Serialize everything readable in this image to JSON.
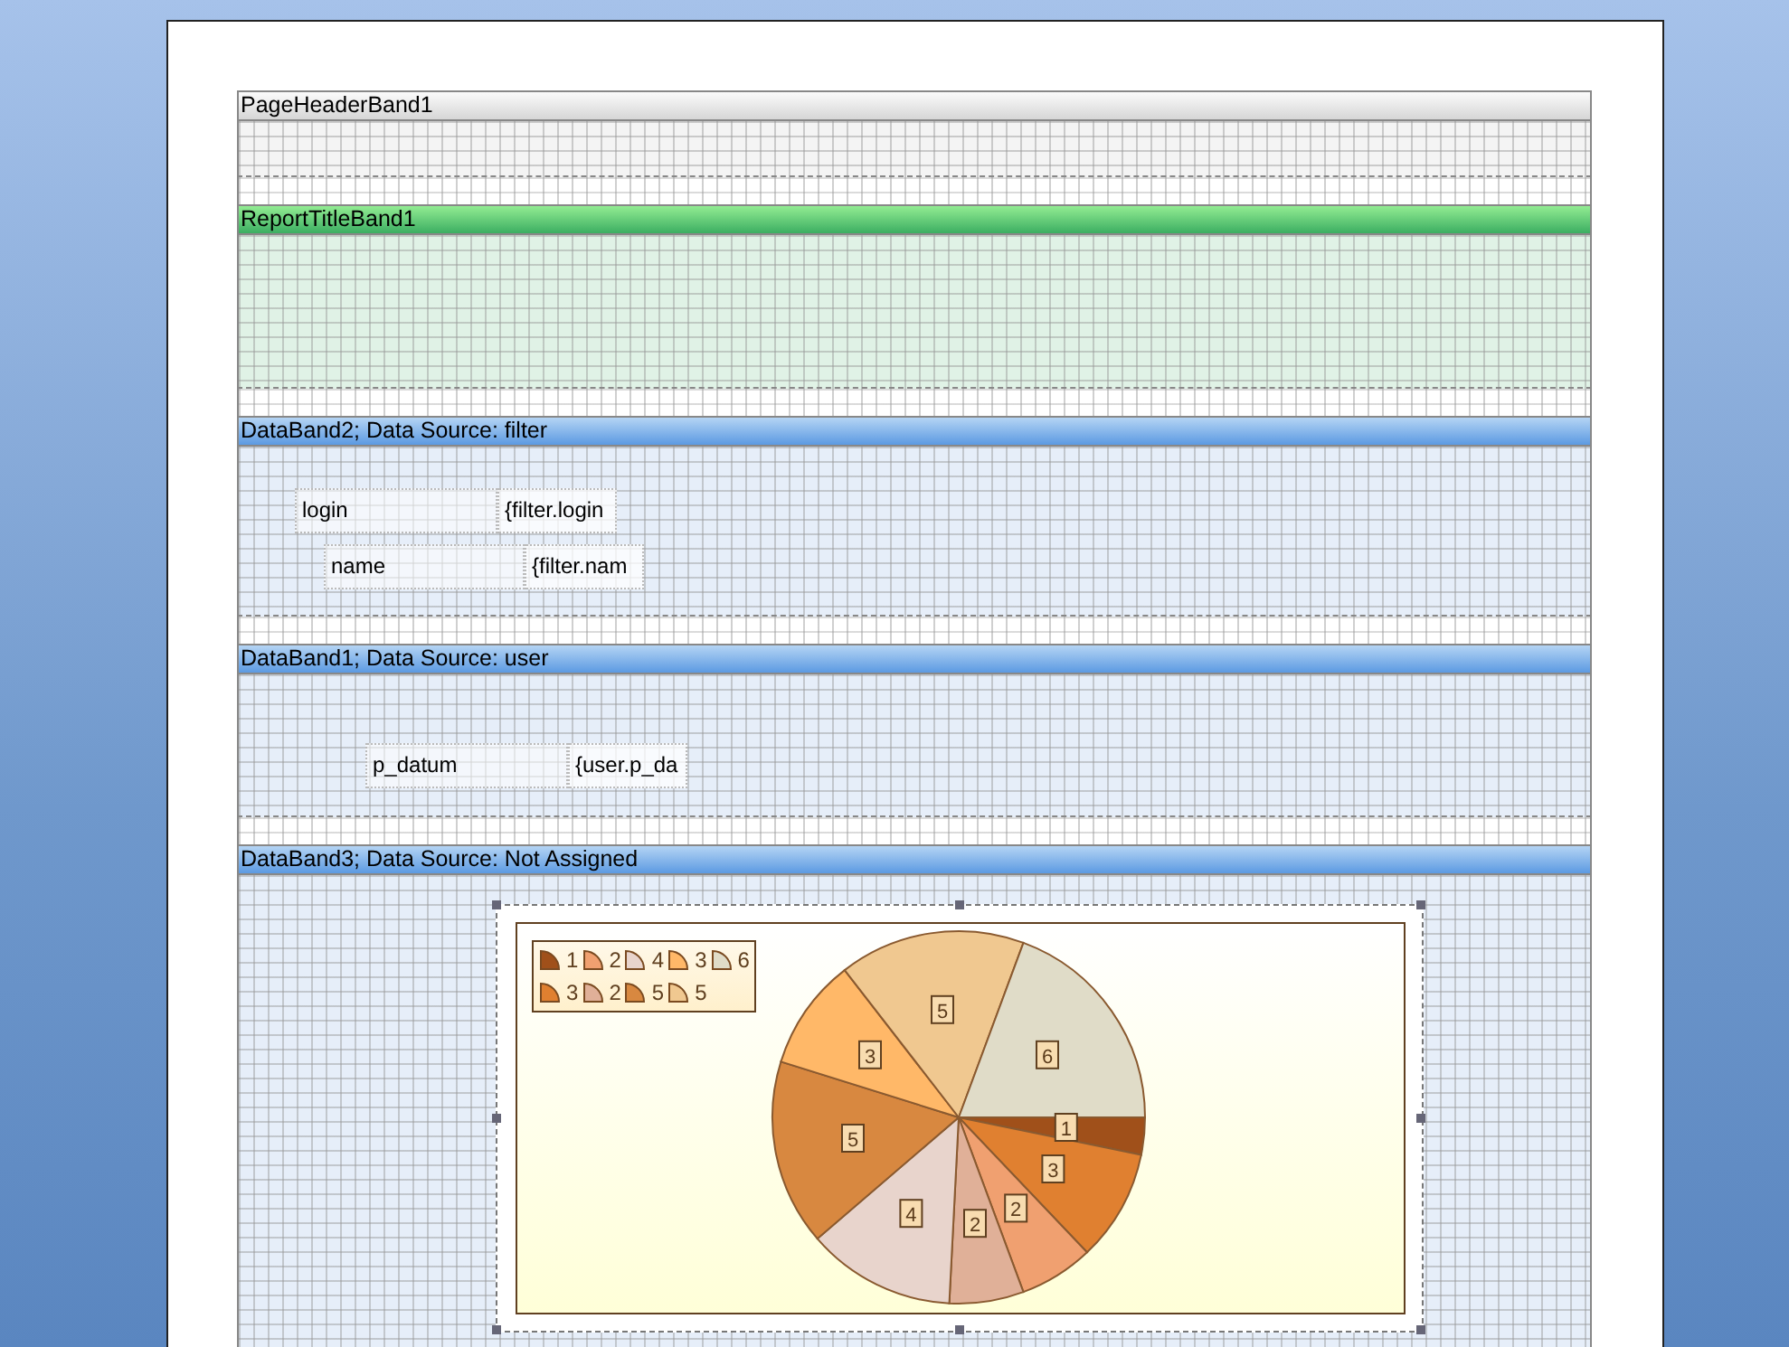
{
  "bands": [
    {
      "title": "PageHeaderBand1",
      "kind": "page_header"
    },
    {
      "title": "ReportTitleBand1",
      "kind": "report_title"
    },
    {
      "title": "DataBand2; Data Source: filter",
      "kind": "data",
      "objects": [
        {
          "kind": "label",
          "text": "login"
        },
        {
          "kind": "field",
          "text": "{filter.login"
        },
        {
          "kind": "label",
          "text": "name"
        },
        {
          "kind": "field",
          "text": "{filter.nam"
        }
      ]
    },
    {
      "title": "DataBand1; Data Source: user",
      "kind": "data",
      "objects": [
        {
          "kind": "label",
          "text": "p_datum"
        },
        {
          "kind": "field",
          "text": "{user.p_da"
        }
      ]
    },
    {
      "title": "DataBand3; Data Source: Not Assigned",
      "kind": "data",
      "objects": [
        {
          "kind": "chart",
          "chart_data": {
            "type": "pie",
            "categories": [
              "1",
              "3",
              "2",
              "2",
              "4",
              "5",
              "3",
              "5",
              "6"
            ],
            "data_labels": true,
            "legend": true,
            "series": [
              {
                "values": [
                  1,
                  3,
                  2,
                  2,
                  4,
                  5,
                  3,
                  5,
                  6
                ]
              }
            ],
            "colors": [
              "#a0501a",
              "#e08030",
              "#f0a070",
              "#e0b098",
              "#e8d4cc",
              "#d88840",
              "#ffb868",
              "#f0c890",
              "#e0dcc8"
            ]
          }
        }
      ]
    }
  ]
}
